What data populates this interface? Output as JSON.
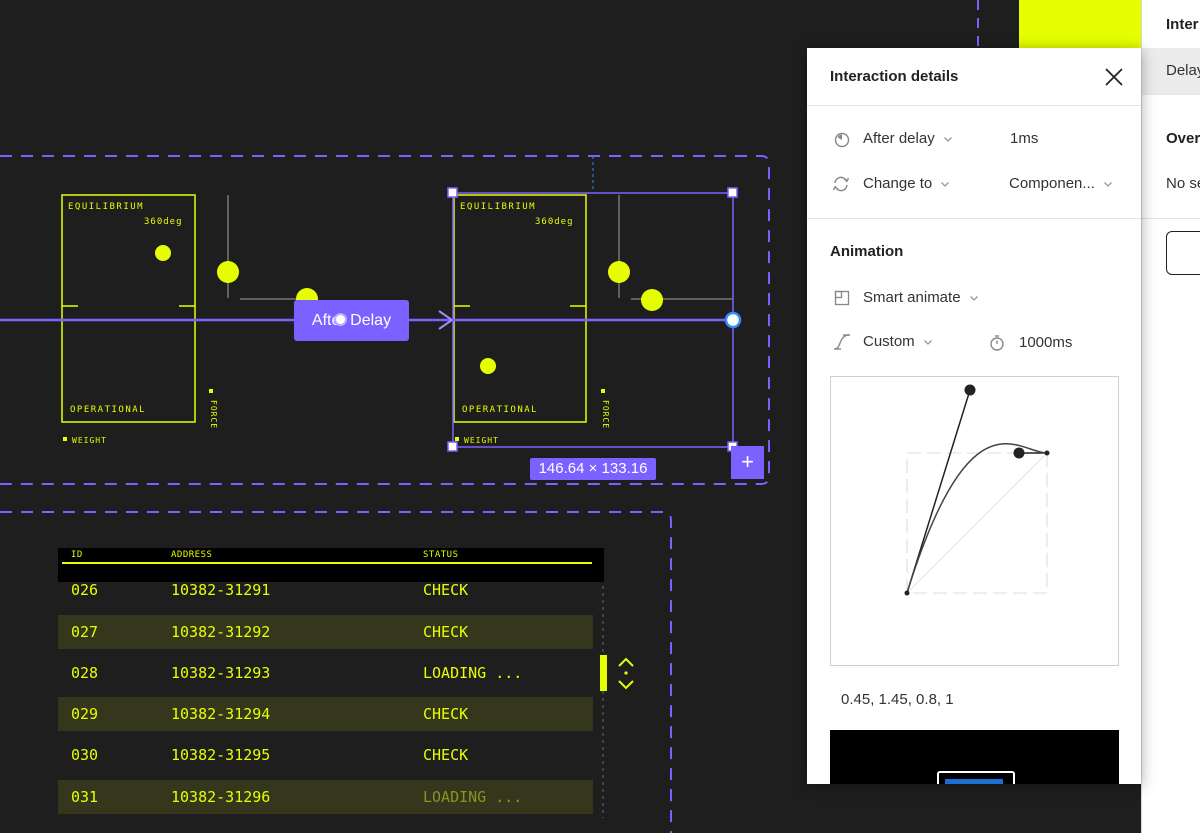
{
  "colors": {
    "canvas_bg": "#1e1e1e",
    "accent_purple": "#7b61ff",
    "neon_yellow": "#e6ff00",
    "row_alt": "#35371c",
    "blue_handle": "#2f8cff"
  },
  "background_panel": {
    "header": "Inter",
    "selected_row": "Delay",
    "section": "Over",
    "value": "No se"
  },
  "modal": {
    "title": "Interaction details",
    "trigger": {
      "icon": "clock-icon",
      "label": "After delay",
      "value": "1ms"
    },
    "action": {
      "icon": "swap-icon",
      "label": "Change to",
      "value": "Componen..."
    },
    "animation_header": "Animation",
    "animation_type": {
      "icon": "smart-animate-icon",
      "label": "Smart animate"
    },
    "easing": {
      "icon": "curve-icon",
      "label": "Custom"
    },
    "duration": {
      "icon": "timer-icon",
      "value": "1000ms"
    },
    "curve_values": "0.45, 1.45, 0.8, 1",
    "bezier": [
      0.45,
      1.45,
      0.8,
      1
    ]
  },
  "canvas": {
    "card_left": {
      "title": "EQUILIBRIUM",
      "angle": "360deg",
      "status": "OPERATIONAL",
      "weight": "WEIGHT",
      "force": "FORCE"
    },
    "card_right": {
      "title": "EQUILIBRIUM",
      "angle": "360deg",
      "status": "OPERATIONAL",
      "weight": "WEIGHT",
      "force": "FORCE"
    },
    "connector_label": "After Delay",
    "dimensions": "146.64 × 133.16",
    "add_button": "+"
  },
  "table": {
    "headers": [
      "ID",
      "ADDRESS",
      "STATUS"
    ],
    "rows": [
      {
        "id": "026",
        "address": "10382-31291",
        "status": "CHECK",
        "dim": false
      },
      {
        "id": "027",
        "address": "10382-31292",
        "status": "CHECK",
        "dim": false
      },
      {
        "id": "028",
        "address": "10382-31293",
        "status": "LOADING ...",
        "dim": false
      },
      {
        "id": "029",
        "address": "10382-31294",
        "status": "CHECK",
        "dim": false
      },
      {
        "id": "030",
        "address": "10382-31295",
        "status": "CHECK",
        "dim": false
      },
      {
        "id": "031",
        "address": "10382-31296",
        "status": "LOADING ...",
        "dim": true
      }
    ]
  }
}
